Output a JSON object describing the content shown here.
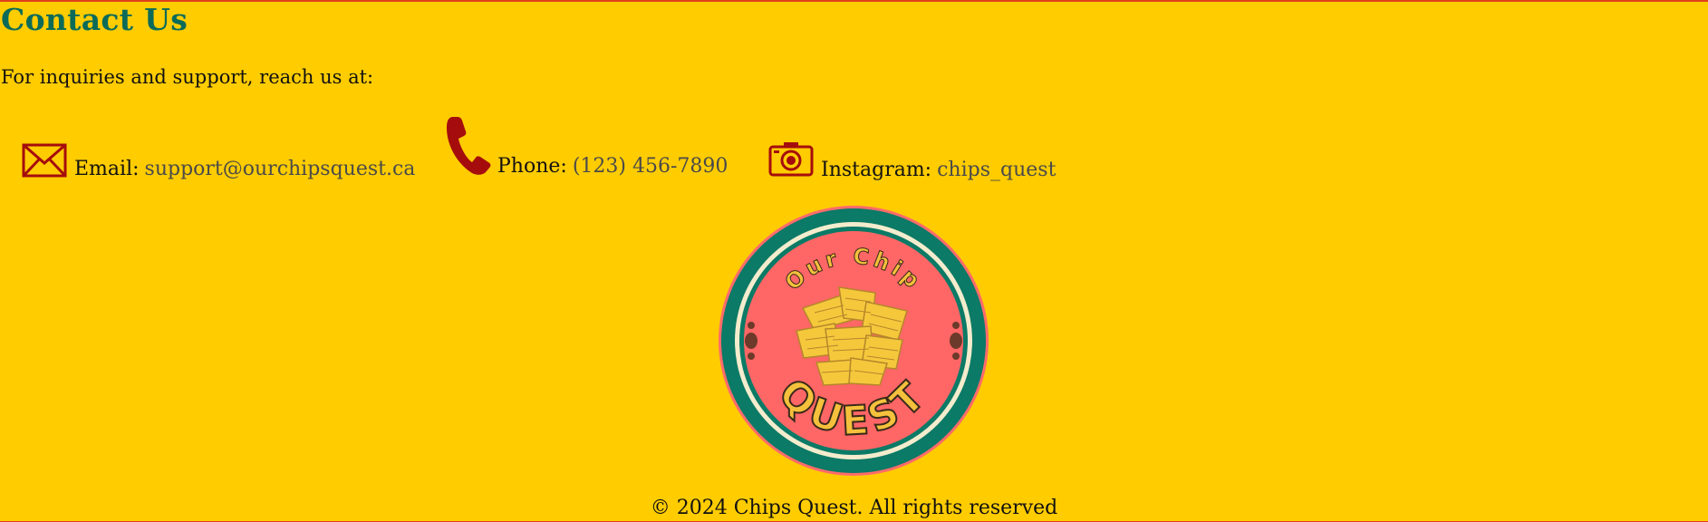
{
  "contact": {
    "title": "Contact Us",
    "intro": "For inquiries and support, reach us at:",
    "items": [
      {
        "label": "Email:",
        "value": "support@ourchipsquest.ca",
        "icon": "envelope-icon"
      },
      {
        "label": "Phone:",
        "value": "(123) 456-7890",
        "icon": "phone-icon"
      },
      {
        "label": "Instagram:",
        "value": "chips_quest",
        "icon": "camera-icon"
      }
    ]
  },
  "logo": {
    "top_text": "Our Chip",
    "bottom_text": "QUEST"
  },
  "footer": {
    "copyright": "© 2024 Chips Quest. All rights reserved"
  },
  "colors": {
    "background": "#ffcc00",
    "title": "#0b6b58",
    "icon": "#a50d0d",
    "logo_ring": "#0b7a66",
    "logo_inner": "#ff6666",
    "logo_text": "#f5c13c"
  }
}
